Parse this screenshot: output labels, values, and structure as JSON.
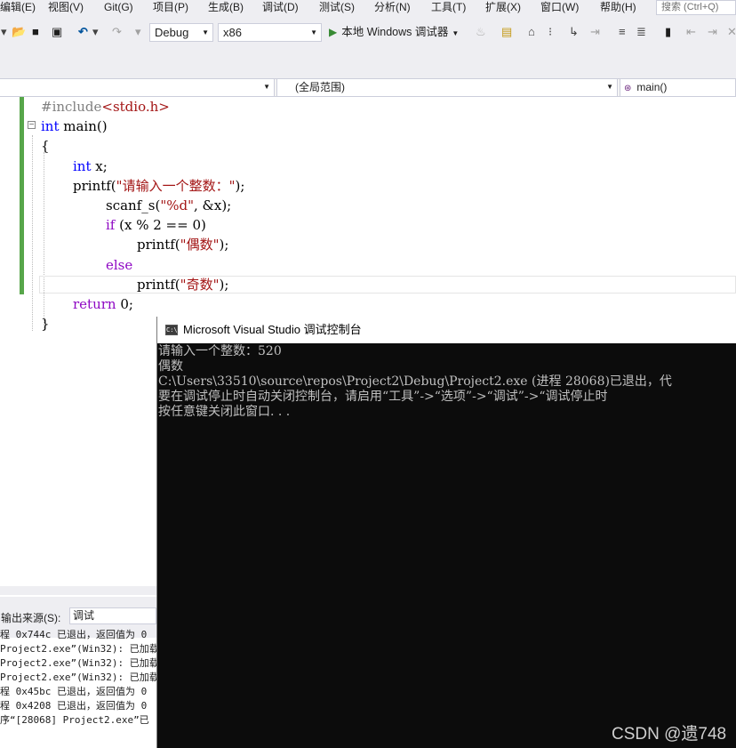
{
  "menubar": {
    "items": [
      "编辑(E)",
      "视图(V)",
      "Git(G)",
      "项目(P)",
      "生成(B)",
      "调试(D)",
      "测试(S)",
      "分析(N)",
      "工具(T)",
      "扩展(X)",
      "窗口(W)",
      "帮助(H)"
    ],
    "search_placeholder": "搜索 (Ctrl+Q)"
  },
  "toolbar": {
    "config": "Debug",
    "platform": "x86",
    "run_label": "本地 Windows 调试器"
  },
  "navbar": {
    "scope": "(全局范围)",
    "member": "main()"
  },
  "editor": {
    "lines": [
      "#include<stdio.h>",
      "int main()",
      "{",
      "    int x;",
      "    printf(\"请输入一个整数：\");",
      "        scanf_s(\"%d\", &x);",
      "        if (x % 2 == 0)",
      "            printf(\"偶数\");",
      "        else",
      "            printf(\"奇数\");",
      "    return 0;",
      "}"
    ]
  },
  "output": {
    "source_label": "输出来源(S):",
    "source_value": "调试",
    "lines": [
      "程 0x744c 已退出，返回值为 0",
      "Project2.exe”(Win32): 已加载",
      "Project2.exe”(Win32): 已加载",
      "Project2.exe”(Win32): 已加载",
      "程 0x45bc 已退出，返回值为 0",
      "程 0x4208 已退出，返回值为 0",
      "序“[28068] Project2.exe”已"
    ]
  },
  "console": {
    "title": "Microsoft Visual Studio 调试控制台",
    "icon_text": "C:\\",
    "lines": [
      "请输入一个整数：520",
      "偶数",
      "C:\\Users\\33510\\source\\repos\\Project2\\Debug\\Project2.exe (进程 28068)已退出，代",
      "要在调试停止时自动关闭控制台，请启用“工具”->“选项”->“调试”->“调试停止时",
      "按任意键关闭此窗口. . ."
    ]
  },
  "watermark": "CSDN @遗748"
}
